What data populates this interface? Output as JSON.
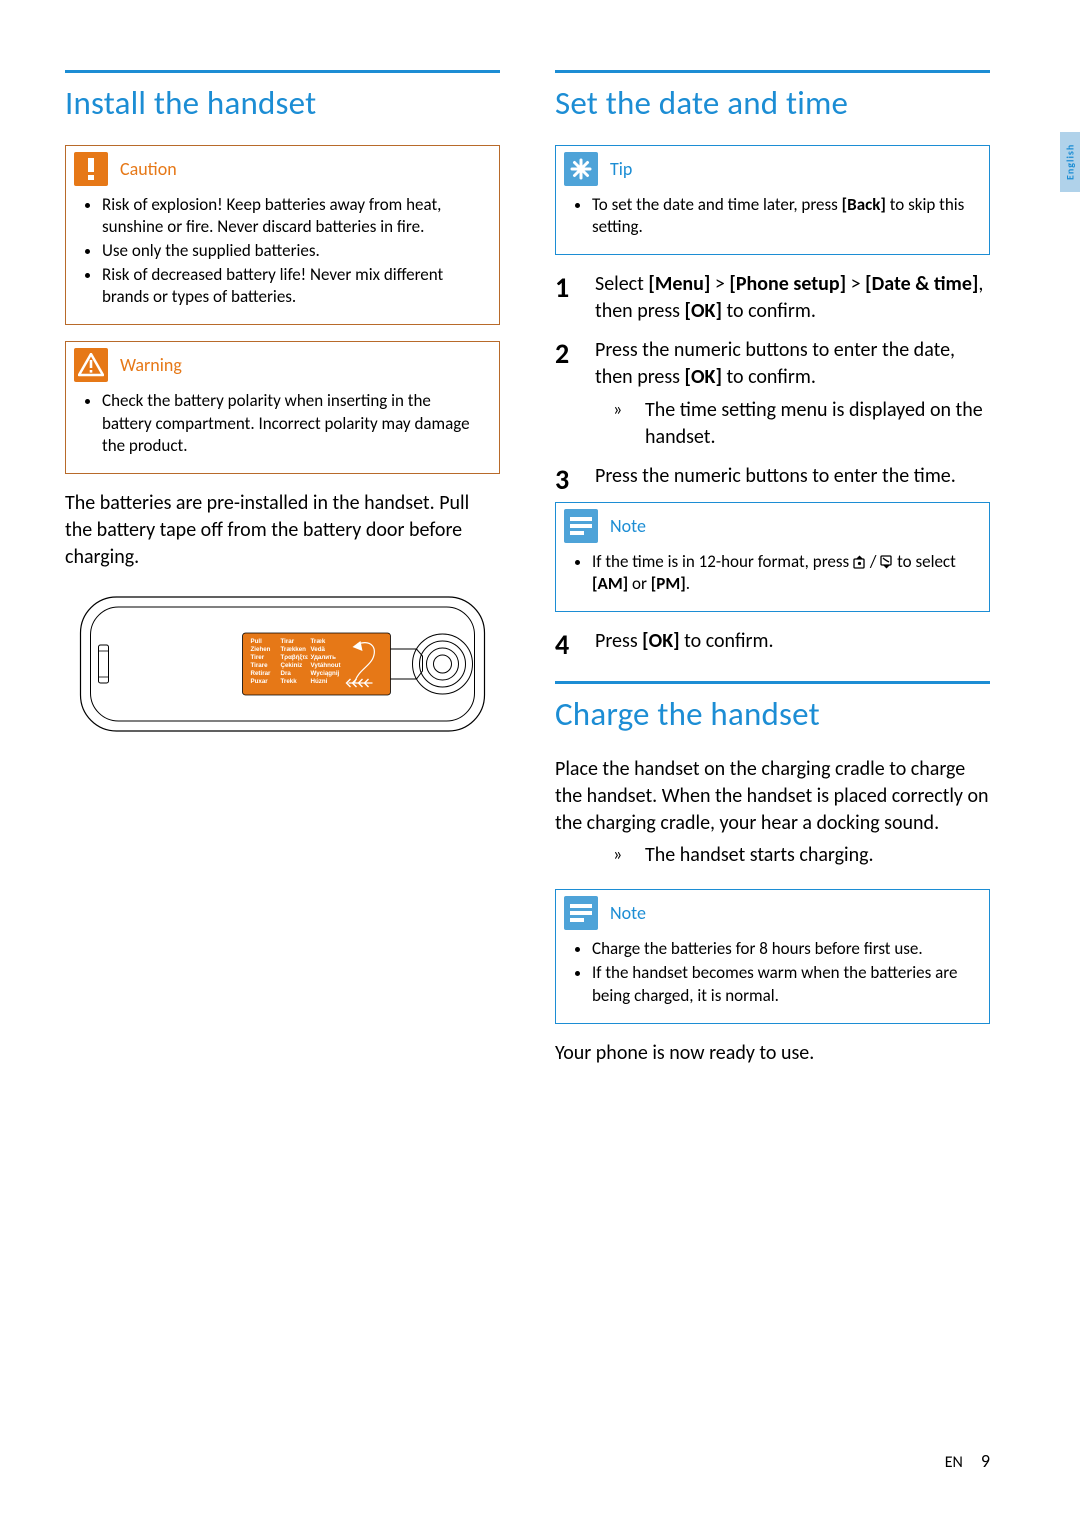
{
  "lang_tab": "English",
  "footer": {
    "lang_code": "EN",
    "page_num": "9"
  },
  "left": {
    "heading": "Install the handset",
    "caution": {
      "title": "Caution",
      "items": [
        "Risk of explosion! Keep batteries away from heat, sunshine or fire. Never discard batteries in fire.",
        "Use only the supplied batteries.",
        "Risk of decreased battery life! Never mix different brands or types of batteries."
      ]
    },
    "warning": {
      "title": "Warning",
      "items": [
        "Check the battery polarity when inserting in the battery compartment. Incorrect polarity may damage the product."
      ]
    },
    "body1": "The batteries are pre-installed in the handset. Pull the battery tape off from the battery door before charging.",
    "pull_label": {
      "col1": [
        "Pull",
        "Ziehen",
        "Tirer",
        "Tirare",
        "Retirar",
        "Puxar"
      ],
      "col2": [
        "Tirar",
        "Trækken",
        "Τραβήξτε",
        "Çekiniz",
        "Dra",
        "Trekk"
      ],
      "col3": [
        "Træk",
        "Vedä",
        "Удалить",
        "Vytáhnout",
        "Wyciągnij",
        "Húzni"
      ]
    }
  },
  "right": {
    "heading_date": "Set the date and time",
    "tip": {
      "title": "Tip",
      "items_prefix": "To set the date and time later, press ",
      "items_bold": "[Back]",
      "items_suffix": " to skip this setting."
    },
    "steps_date": {
      "s1_a": "Select ",
      "s1_b": "[Menu]",
      "s1_c": " > ",
      "s1_d": "[Phone setup]",
      "s1_e": " > ",
      "s1_f": "[Date & time]",
      "s1_g": ", then press ",
      "s1_h": "[OK]",
      "s1_i": " to confirm.",
      "s2_a": "Press the numeric buttons to enter the date, then press ",
      "s2_b": "[OK]",
      "s2_c": " to confirm.",
      "s2_sub": "The time setting menu is displayed on the handset.",
      "s3": "Press the numeric buttons to enter the time."
    },
    "note1": {
      "title": "Note",
      "item_a": "If the time is in 12-hour format, press ",
      "item_b": " / ",
      "item_c": " to select ",
      "item_d": "[AM]",
      "item_e": " or ",
      "item_f": "[PM]",
      "item_g": "."
    },
    "step4_a": "Press ",
    "step4_b": "[OK]",
    "step4_c": " to confirm.",
    "heading_charge": "Charge the handset",
    "charge_body": "Place the handset on the charging cradle to charge the handset. When the handset is placed correctly on the charging cradle, your hear a docking sound.",
    "charge_sub": "The handset starts charging.",
    "note2": {
      "title": "Note",
      "items": [
        "Charge the batteries for 8 hours before first use.",
        "If the handset becomes warm when the batteries are being charged, it is normal."
      ]
    },
    "ready": "Your phone is now ready to use."
  }
}
